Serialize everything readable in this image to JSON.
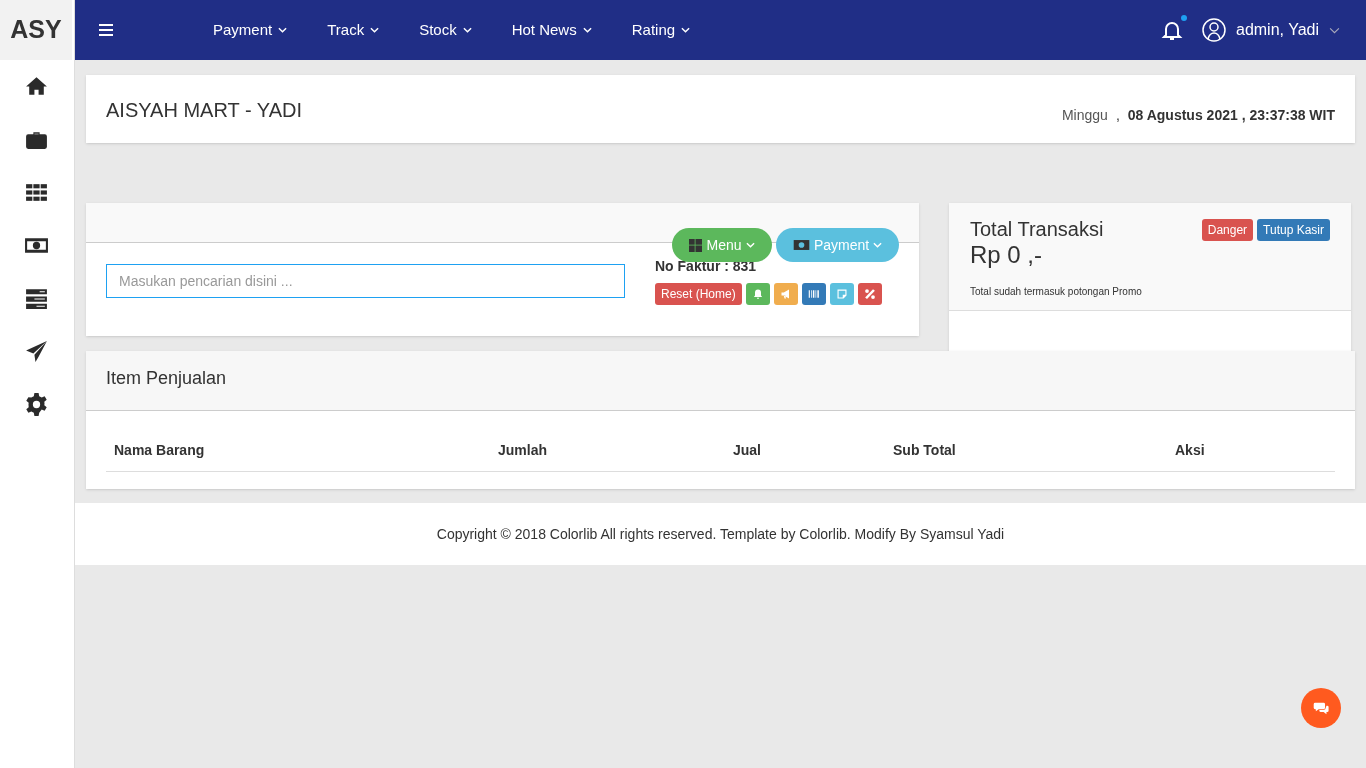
{
  "brand": "ASY",
  "nav": [
    {
      "label": "Payment"
    },
    {
      "label": "Track"
    },
    {
      "label": "Stock"
    },
    {
      "label": "Hot News"
    },
    {
      "label": "Rating"
    }
  ],
  "notifications": {
    "unread": true
  },
  "user": {
    "name": "admin, Yadi"
  },
  "header": {
    "title": "AISYAH MART - YADI",
    "day": "Minggu",
    "separator": ",",
    "datetime": "08 Agustus 2021 , 23:37:38 WIT"
  },
  "sale": {
    "menu_button": "Menu",
    "payment_button": "Payment",
    "search": {
      "placeholder": "Masukan pencarian disini ..."
    },
    "invoice": "No Faktur : 831",
    "reset_button": "Reset (Home)"
  },
  "total": {
    "title": "Total Transaksi",
    "amount": "Rp 0 ,-",
    "note": "Total sudah termasuk potongan Promo",
    "buttons": [
      {
        "label": "Danger",
        "kind": "danger"
      },
      {
        "label": "Tutup Kasir",
        "kind": "primary"
      }
    ]
  },
  "items": {
    "title": "Item Penjualan",
    "columns": [
      "Nama Barang",
      "Jumlah",
      "Jual",
      "Sub Total",
      "Aksi"
    ]
  },
  "footer": "Copyright © 2018 Colorlib All rights reserved. Template by Colorlib. Modify By Syamsul Yadi"
}
